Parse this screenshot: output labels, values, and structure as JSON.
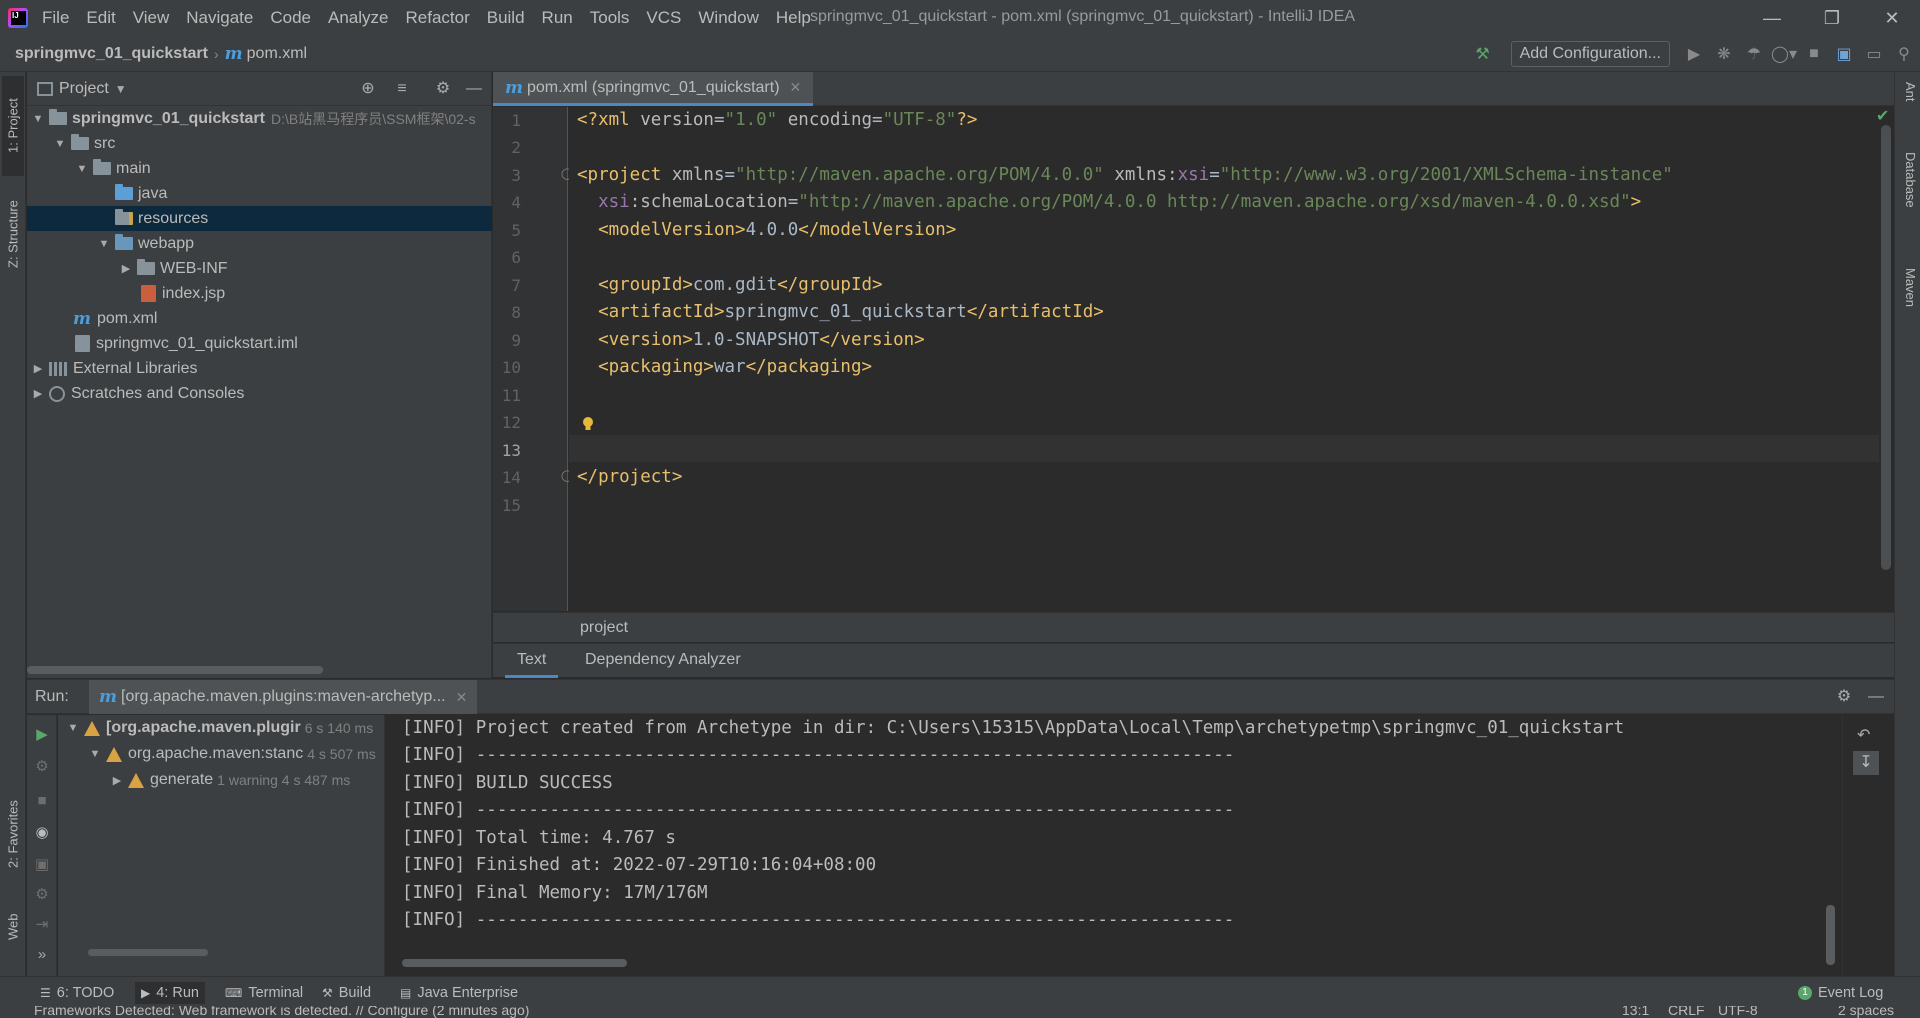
{
  "menu": {
    "items": [
      "File",
      "Edit",
      "View",
      "Navigate",
      "Code",
      "Analyze",
      "Refactor",
      "Build",
      "Run",
      "Tools",
      "VCS",
      "Window",
      "Help"
    ],
    "window_title": "springmvc_01_quickstart - pom.xml (springmvc_01_quickstart) - IntelliJ IDEA"
  },
  "navbar": {
    "project": "springmvc_01_quickstart",
    "file": "pom.xml",
    "add_configuration": "Add Configuration..."
  },
  "left_strip": {
    "project_tab": "1: Project",
    "structure_tab": "Z: Structure",
    "favorites_tab": "2: Favorites",
    "web_tab": "Web"
  },
  "right_strip": {
    "ant_tab": "Ant",
    "database_tab": "Database",
    "maven_tab": "Maven"
  },
  "project_panel": {
    "title": "Project",
    "tree": [
      {
        "label": "springmvc_01_quickstart",
        "hint": "D:\\B站黑马程序员\\SSM框架\\02-s"
      },
      {
        "label": "src"
      },
      {
        "label": "main"
      },
      {
        "label": "java"
      },
      {
        "label": "resources"
      },
      {
        "label": "webapp"
      },
      {
        "label": "WEB-INF"
      },
      {
        "label": "index.jsp"
      },
      {
        "label": "pom.xml"
      },
      {
        "label": "springmvc_01_quickstart.iml"
      },
      {
        "label": "External Libraries"
      },
      {
        "label": "Scratches and Consoles"
      }
    ]
  },
  "editor": {
    "tab_label": "pom.xml (springmvc_01_quickstart)",
    "line_numbers": [
      "1",
      "2",
      "3",
      "4",
      "5",
      "6",
      "7",
      "8",
      "9",
      "10",
      "11",
      "12",
      "13",
      "14",
      "15"
    ],
    "breadcrumb": "project",
    "bottom_tabs": [
      "Text",
      "Dependency Analyzer"
    ],
    "code": {
      "l1_pi_open": "<?xml ",
      "l1_attr1": "version",
      "l1_val1": "\"1.0\"",
      "l1_attr2": " encoding",
      "l1_val2": "\"UTF-8\"",
      "l1_pi_close": "?>",
      "l3_tag": "<project ",
      "l3_attr1": "xmlns",
      "l3_val1": "\"http://maven.apache.org/POM/4.0.0\"",
      "l3_attr2": " xmlns:",
      "l3_ns": "xsi",
      "l3_val2": "\"http://www.w3.org/2001/XMLSchema-instance\"",
      "l4_ns": "xsi",
      "l4_attr": ":schemaLocation",
      "l4_val": "\"http://maven.apache.org/POM/4.0.0 http://maven.apache.org/xsd/maven-4.0.0.xsd\"",
      "l4_close": ">",
      "l5_open": "<modelVersion>",
      "l5_text": "4.0.0",
      "l5_close": "</modelVersion>",
      "l7_open": "<groupId>",
      "l7_text": "com.gdit",
      "l7_close": "</groupId>",
      "l8_open": "<artifactId>",
      "l8_text": "springmvc_01_quickstart",
      "l8_close": "</artifactId>",
      "l9_open": "<version>",
      "l9_text": "1.0-SNAPSHOT",
      "l9_close": "</version>",
      "l10_open": "<packaging>",
      "l10_text": "war",
      "l10_close": "</packaging>",
      "l14_tag": "</project>"
    }
  },
  "run_panel": {
    "label": "Run:",
    "tab_label": "[org.apache.maven.plugins:maven-archetyp...",
    "tree": [
      {
        "label": "[org.apache.maven.plugir",
        "time": "6 s 140 ms"
      },
      {
        "label": "org.apache.maven:stanc",
        "time": "4 s 507 ms"
      },
      {
        "label": "generate",
        "time": "1 warning   4 s 487 ms"
      }
    ],
    "console": [
      "[INFO] Project created from Archetype in dir: C:\\Users\\15315\\AppData\\Local\\Temp\\archetypetmp\\springmvc_01_quickstart",
      "[INFO] ------------------------------------------------------------------------",
      "[INFO] BUILD SUCCESS",
      "[INFO] ------------------------------------------------------------------------",
      "[INFO] Total time: 4.767 s",
      "[INFO] Finished at: 2022-07-29T10:16:04+08:00",
      "[INFO] Final Memory: 17M/176M",
      "[INFO] ------------------------------------------------------------------------"
    ]
  },
  "toolwindows": {
    "todo": "6: TODO",
    "run": "4: Run",
    "terminal": "Terminal",
    "build": "Build",
    "java_enterprise": "Java Enterprise",
    "event_log": "Event Log"
  },
  "status": {
    "message": "Frameworks Detected: Web framework is detected. // Configure (2 minutes ago)",
    "position": "13:1",
    "line_sep": "CRLF",
    "encoding": "UTF-8",
    "indent": "2 spaces"
  }
}
